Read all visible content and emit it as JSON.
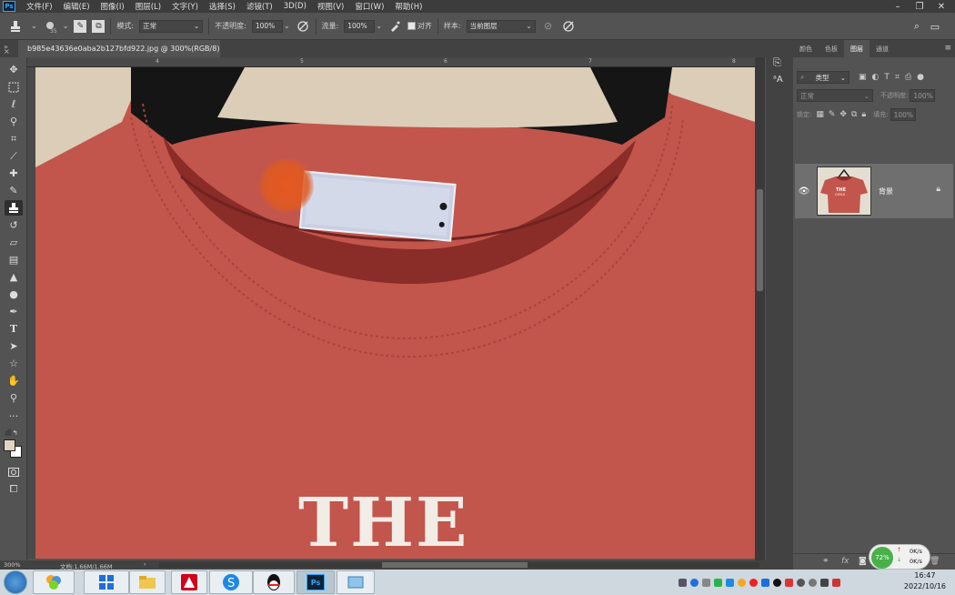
{
  "app": {
    "logo": "Ps"
  },
  "menu": [
    "文件(F)",
    "编辑(E)",
    "图像(I)",
    "图层(L)",
    "文字(Y)",
    "选择(S)",
    "滤镜(T)",
    "3D(D)",
    "视图(V)",
    "窗口(W)",
    "帮助(H)"
  ],
  "options_bar": {
    "brush_size": "35",
    "mode_label": "模式:",
    "mode_value": "正常",
    "opacity_label": "不透明度:",
    "opacity_value": "100%",
    "flow_label": "流量:",
    "flow_value": "100%",
    "aligned_label": "对齐",
    "sample_label": "样本:",
    "sample_value": "当前图层"
  },
  "document": {
    "tab_title": "b985e43636e0aba2b127bfd922.jpg @ 300%(RGB/8)",
    "tab_close": "×",
    "ruler_labels": [
      "4",
      "5",
      "6",
      "7",
      "8"
    ],
    "shirt_text": "THE"
  },
  "status": {
    "zoom": "300%",
    "doc_info": "文档:1.66M/1.66M"
  },
  "panels": {
    "tabs": [
      "颜色",
      "色板",
      "图层",
      "通道"
    ],
    "active_tab": "图层",
    "filter_label": "类型",
    "blend_mode": "正常",
    "opacity_label": "不透明度:",
    "opacity_value": "100%",
    "lock_label": "锁定:",
    "fill_label": "填充:",
    "fill_value": "100%",
    "layer_name": "背景",
    "thumb_text": "THE",
    "thumb_subtext": "CHYLE",
    "fx_label": "fx"
  },
  "taskbar": {
    "clock_time": "16:47",
    "clock_date": "2022/10/16",
    "net_percent": "72%",
    "net_up": "0K/s",
    "net_down": "0K/s"
  },
  "colors": {
    "shirt": "#c2564c",
    "collar": "#8a2c28",
    "fg_swatch": "#e2d4bf",
    "accent": "#31a8ff"
  }
}
